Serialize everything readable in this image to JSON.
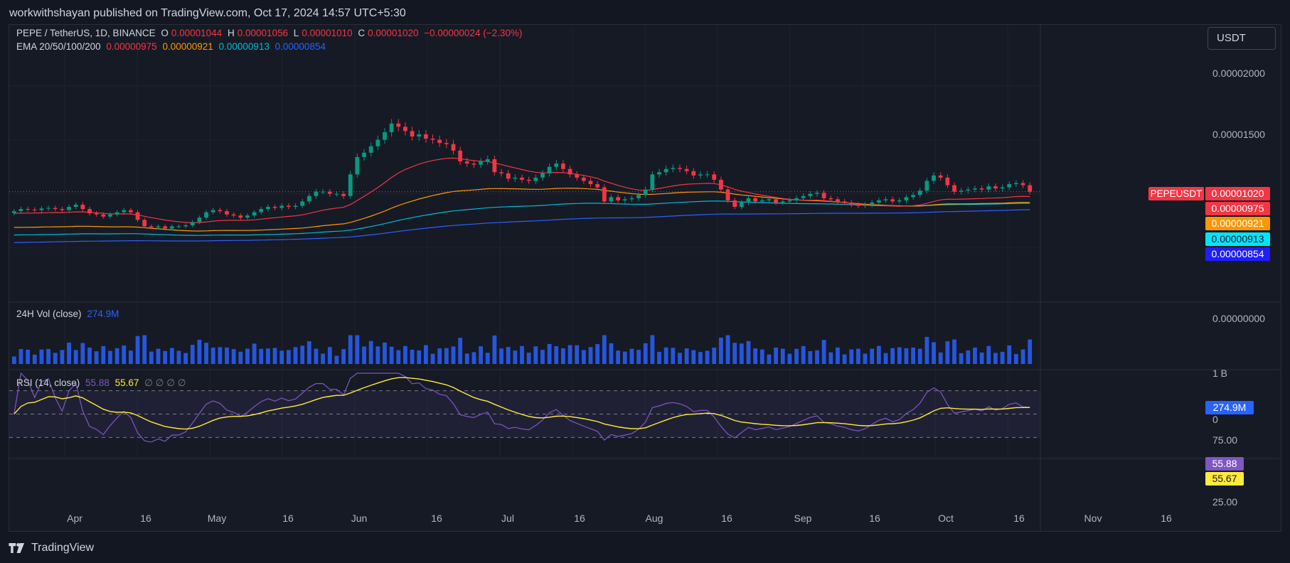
{
  "publish": {
    "text": "workwithshayan published on TradingView.com, Oct 17, 2024 14:57 UTC+5:30"
  },
  "legend": {
    "symbol": "PEPE / TetherUS, 1D, BINANCE",
    "o_key": "O",
    "o_val": "0.00001044",
    "h_key": "H",
    "h_val": "0.00001056",
    "l_key": "L",
    "l_val": "0.00001010",
    "c_key": "C",
    "c_val": "0.00001020",
    "change": "−0.00000024 (−2.30%)",
    "ema_label": "EMA 20/50/100/200",
    "ema_values": [
      "0.00000975",
      "0.00000921",
      "0.00000913",
      "0.00000854"
    ],
    "vol_label": "24H Vol (close)",
    "vol_value": "274.9M",
    "rsi_label": "RSI (14, close)",
    "rsi_value": "55.88",
    "rsi_ma": "55.67",
    "rsi_extra": "∅  ∅  ∅  ∅"
  },
  "currency": "USDT",
  "price_axis": [
    "0.00002000",
    "0.00001500",
    "0.00000000"
  ],
  "tags": {
    "symbol": "PEPEUSDT",
    "last_price": "0.00001020",
    "ema20": "0.00000975",
    "ema50": "0.00000921",
    "ema100": "0.00000913",
    "ema200": "0.00000854",
    "vol": "274.9M",
    "rsi": "55.88",
    "rsi_ma": "55.67"
  },
  "vol_axis": [
    "1 B",
    "0"
  ],
  "rsi_axis": [
    "75.00",
    "25.00"
  ],
  "time_axis": [
    "Apr",
    "16",
    "May",
    "16",
    "Jun",
    "16",
    "Jul",
    "16",
    "Aug",
    "16",
    "Sep",
    "16",
    "Oct",
    "16",
    "Nov",
    "16"
  ],
  "colors": {
    "up": "#089981",
    "down": "#f23645",
    "ema20": "#f23645",
    "ema50": "#ff9800",
    "ema100": "#00bcd4",
    "ema200": "#2962ff",
    "volume": "#2962ff",
    "rsi": "#7e57c2",
    "rsi_ma": "#ffeb3b"
  },
  "footer": {
    "brand": "TradingView"
  },
  "chart_data": {
    "type": "candlestick",
    "symbol": "PEPEUSDT",
    "interval": "1D",
    "price_range": [
      0,
      2.2e-05
    ],
    "closes_approx": [
      8.4e-06,
      8.6e-06,
      8.55e-06,
      8.5e-06,
      8.65e-06,
      8.7e-06,
      8.6e-06,
      8.5e-06,
      8.8e-06,
      9e-06,
      8.6e-06,
      8.2e-06,
      8.1e-06,
      7.9e-06,
      8.1e-06,
      8.3e-06,
      8.5e-06,
      8.3e-06,
      7.6e-06,
      7e-06,
      6.9e-06,
      7e-06,
      6.8e-06,
      7e-06,
      7e-06,
      7.1e-06,
      7.4e-06,
      7.8e-06,
      8.3e-06,
      8.5e-06,
      8.4e-06,
      8.1e-06,
      8e-06,
      7.8e-06,
      8e-06,
      8.3e-06,
      8.6e-06,
      8.8e-06,
      8.7e-06,
      8.9e-06,
      8.8e-06,
      8.9e-06,
      9.3e-06,
      9.8e-06,
      1.02e-05,
      1.02e-05,
      1e-05,
      1e-05,
      9.8e-06,
      1.18e-05,
      1.34e-05,
      1.38e-05,
      1.44e-05,
      1.5e-05,
      1.57e-05,
      1.65e-05,
      1.62e-05,
      1.58e-05,
      1.53e-05,
      1.55e-05,
      1.51e-05,
      1.5e-05,
      1.47e-05,
      1.46e-05,
      1.4e-05,
      1.3e-05,
      1.28e-05,
      1.27e-05,
      1.3e-05,
      1.32e-05,
      1.2e-05,
      1.19e-05,
      1.14e-05,
      1.15e-05,
      1.13e-05,
      1.12e-05,
      1.15e-05,
      1.19e-05,
      1.25e-05,
      1.28e-05,
      1.23e-05,
      1.18e-05,
      1.15e-05,
      1.12e-05,
      1.09e-05,
      1.06e-05,
      9.3e-06,
      9.7e-06,
      9.4e-06,
      9.5e-06,
      9.6e-06,
      9.9e-06,
      1.04e-05,
      1.18e-05,
      1.2e-05,
      1.23e-05,
      1.24e-05,
      1.23e-05,
      1.21e-05,
      1.17e-05,
      1.18e-05,
      1.18e-05,
      1.13e-05,
      1.04e-05,
      9.4e-06,
      8.8e-06,
      9.2e-06,
      9.6e-06,
      9.3e-06,
      9.4e-06,
      9.5e-06,
      9.2e-06,
      9.3e-06,
      9.4e-06,
      9.6e-06,
      9.8e-06,
      1e-05,
      1.01e-05,
      9.6e-06,
      9.5e-06,
      9.3e-06,
      9.2e-06,
      9e-06,
      8.9e-06,
      9e-06,
      9.2e-06,
      9.4e-06,
      9.5e-06,
      9.3e-06,
      9.4e-06,
      9.7e-06,
      9.9e-06,
      1.03e-05,
      1.12e-05,
      1.17e-05,
      1.15e-05,
      1.08e-05,
      1.02e-05,
      1.03e-05,
      1.04e-05,
      1.05e-05,
      1.04e-05,
      1.07e-05,
      1.05e-05,
      1.06e-05,
      1.09e-05,
      1.1e-05,
      1.08e-05,
      1.02e-05
    ],
    "ema_series": [
      "EMA 20",
      "EMA 50",
      "EMA 100",
      "EMA 200"
    ],
    "ema_last": [
      9.75e-06,
      9.21e-06,
      9.13e-06,
      8.54e-06
    ],
    "volume_last": "274.9M",
    "rsi_last": 55.88,
    "rsi_ma_last": 55.67,
    "rsi_levels": [
      70,
      50,
      30
    ]
  }
}
